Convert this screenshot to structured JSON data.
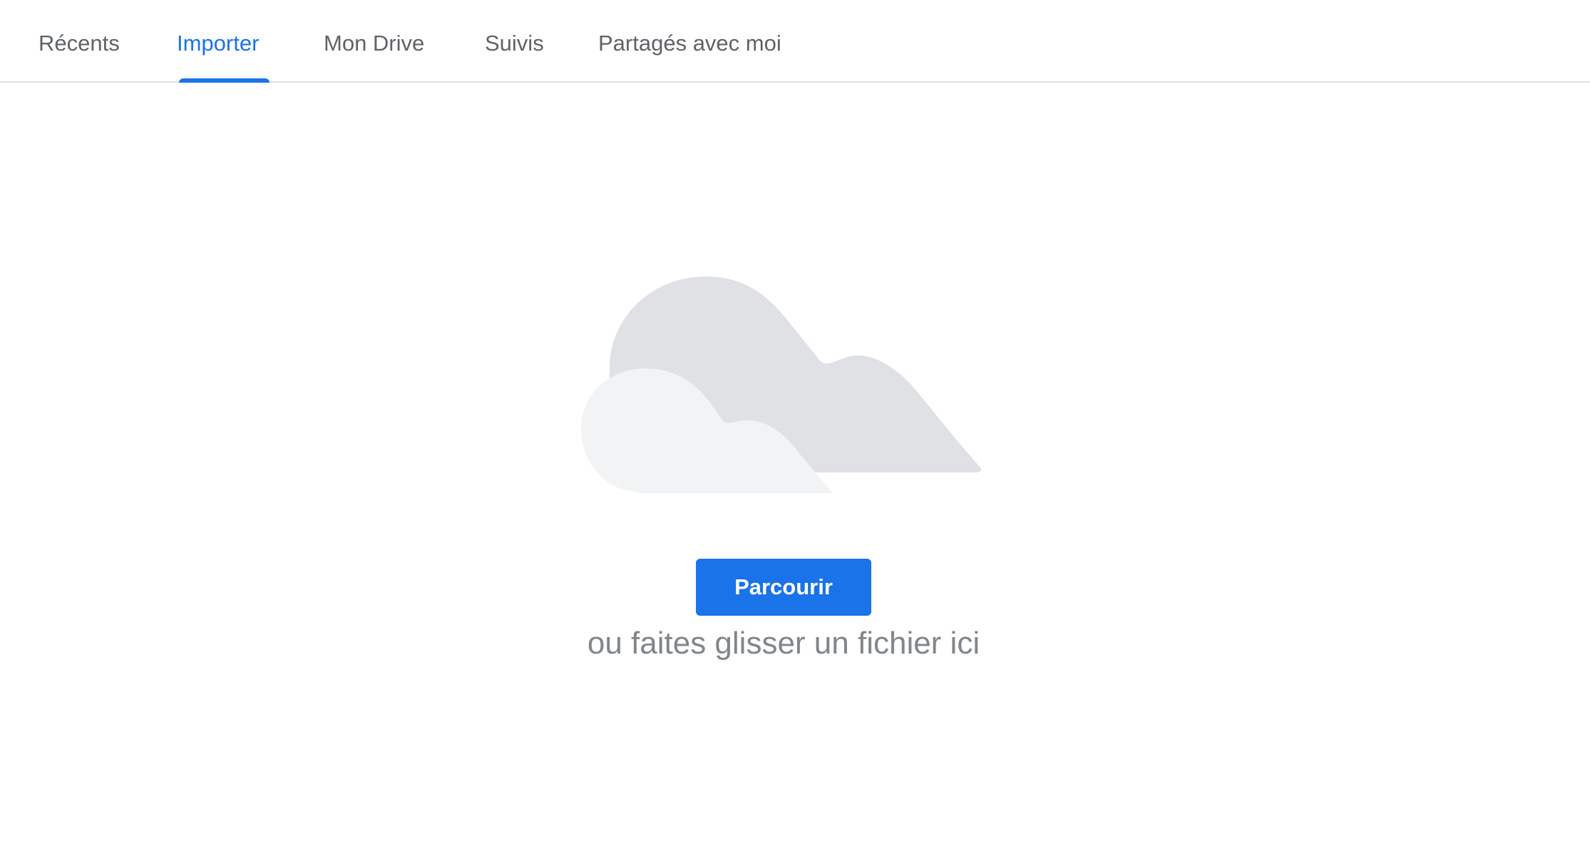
{
  "tabs": [
    {
      "label": "Récents",
      "active": false
    },
    {
      "label": "Importer",
      "active": true
    },
    {
      "label": "Mon Drive",
      "active": false
    },
    {
      "label": "Suivis",
      "active": false
    },
    {
      "label": "Partagés avec moi",
      "active": false
    }
  ],
  "upload": {
    "illustration_icon": "cloud-icon",
    "browse_label": "Parcourir",
    "drop_hint": "ou faites glisser un fichier ici"
  },
  "colors": {
    "accent": "#1a73e8",
    "tab_inactive": "#5f6368",
    "hint_text": "#80868b",
    "cloud_back": "#dfe1e5",
    "cloud_front": "#f1f3f4"
  }
}
